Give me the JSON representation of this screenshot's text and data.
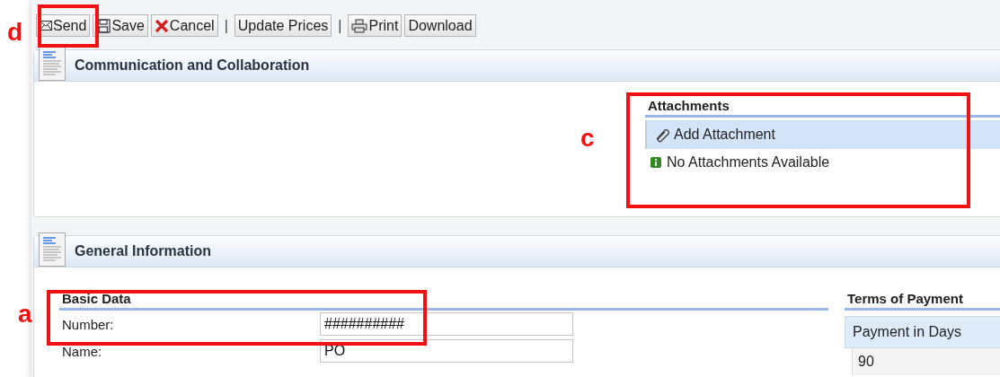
{
  "toolbar": [
    {
      "kind": "mail",
      "label": "Send"
    },
    {
      "kind": "save",
      "label": "Save"
    },
    {
      "kind": "cancel",
      "label": "Cancel"
    },
    {
      "kind": "separator",
      "label": "|"
    },
    {
      "kind": "plain",
      "label": "Update Prices"
    },
    {
      "kind": "separator",
      "label": "|"
    },
    {
      "kind": "print",
      "label": "Print"
    },
    {
      "kind": "plain",
      "label": "Download"
    }
  ],
  "communication_panel": {
    "title": "Communication and Collaboration",
    "attachments": {
      "title": "Attachments",
      "action": "Add Attachment",
      "message": "No Attachments Available"
    }
  },
  "general_panel": {
    "title": "General Information",
    "basic_data": {
      "title": "Basic Data",
      "fields": [
        {
          "label": "Number:",
          "value": "##########"
        },
        {
          "label": "Name:",
          "value": "PO"
        }
      ]
    },
    "terms_of_payment": {
      "title": "Terms of Payment",
      "column": "Payment in Days",
      "value": "90"
    }
  },
  "callouts": [
    {
      "label": "d"
    },
    {
      "label": "c"
    },
    {
      "label": "a"
    }
  ]
}
